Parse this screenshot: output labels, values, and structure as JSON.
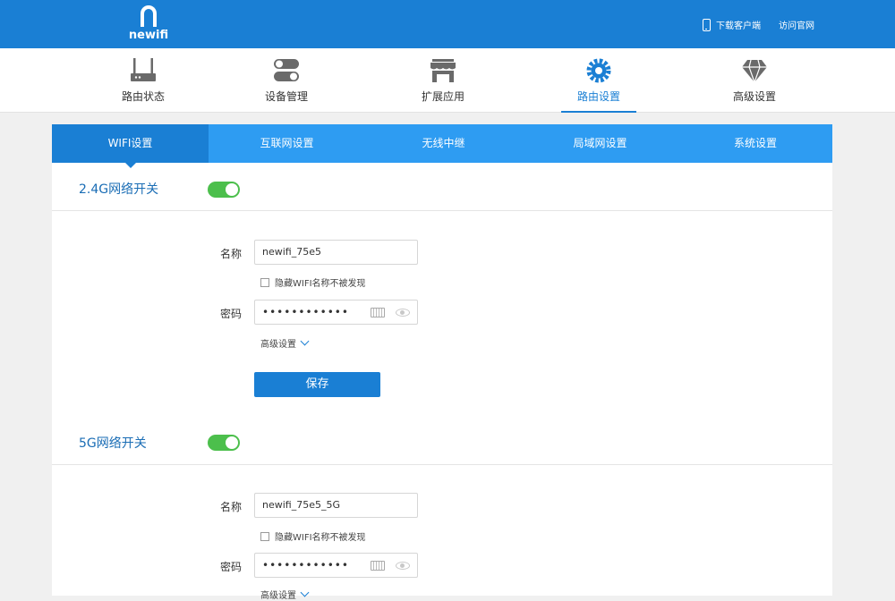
{
  "header": {
    "logo_text": "newifi",
    "download_client": "下载客户端",
    "visit_site": "访问官网"
  },
  "main_nav": [
    {
      "label": "路由状态",
      "icon": "router-icon"
    },
    {
      "label": "设备管理",
      "icon": "toggles-icon"
    },
    {
      "label": "扩展应用",
      "icon": "store-icon"
    },
    {
      "label": "路由设置",
      "icon": "gear-icon",
      "active": true
    },
    {
      "label": "高级设置",
      "icon": "diamond-icon"
    }
  ],
  "tabs": [
    {
      "label": "WIFI设置",
      "active": true
    },
    {
      "label": "互联网设置"
    },
    {
      "label": "无线中继"
    },
    {
      "label": "局域网设置"
    },
    {
      "label": "系统设置"
    }
  ],
  "wifi_24g": {
    "title": "2.4G网络开关",
    "enabled": true,
    "name_label": "名称",
    "name_value": "newifi_75e5",
    "hide_ssid_label": "隐藏WIFI名称不被发现",
    "password_label": "密码",
    "password_mask": "••••••••••••",
    "advanced_label": "高级设置",
    "save_label": "保存"
  },
  "wifi_5g": {
    "title": "5G网络开关",
    "enabled": true,
    "name_label": "名称",
    "name_value": "newifi_75e5_5G",
    "hide_ssid_label": "隐藏WIFI名称不被发现",
    "password_label": "密码",
    "password_mask": "••••••••••••",
    "advanced_label": "高级设置"
  },
  "colors": {
    "brand_blue": "#1a7fd4",
    "tab_blue": "#2e9cf2",
    "toggle_on": "#4cbf4c"
  }
}
